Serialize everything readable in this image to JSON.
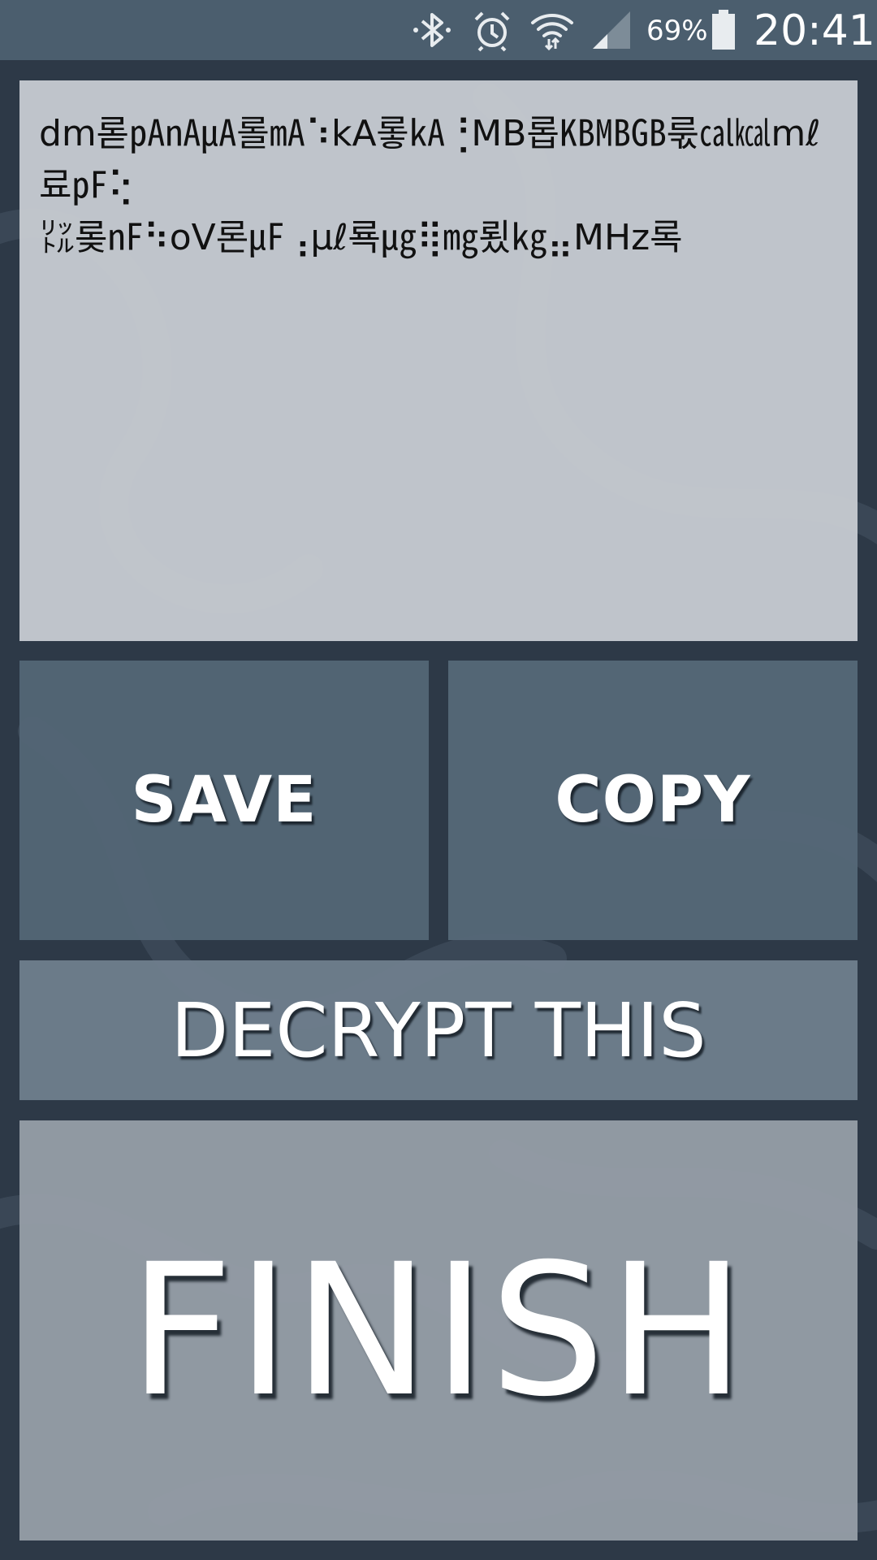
{
  "status_bar": {
    "icons": [
      "bluetooth-icon",
      "alarm-icon",
      "wifi-icon",
      "signal-icon",
      "battery-icon"
    ],
    "battery_percent": "69%",
    "time": "20:41"
  },
  "editor": {
    "text": "dm롣㎀㎁㎂롤㎃⠱kA롷㎄⢘MB롭㎅㎆㎇룫㎈㎉mℓ료㎊⢕\n㍑롲㎋⠳oV론㎌⢠µℓ룍㎍⢿㎎룄㎏⣤MHz록"
  },
  "buttons": {
    "save_label": "SAVE",
    "copy_label": "COPY",
    "decrypt_label": "DECRYPT THIS",
    "finish_label": "FINISH"
  },
  "colors": {
    "background": "#2e3a48",
    "status_bar": "#4b5e6e",
    "text_area": "#c6cad0",
    "save_copy_buttons": "#536575",
    "decrypt_button": "#6d7d8b",
    "finish_button": "#969ea8",
    "button_text": "#ffffff"
  }
}
